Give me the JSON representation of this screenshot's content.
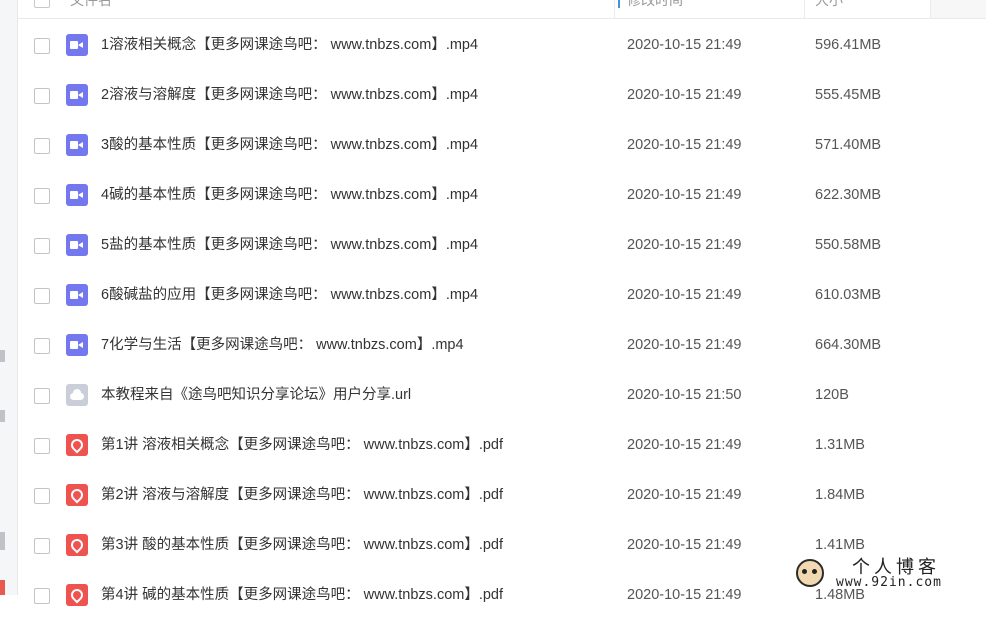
{
  "header": {
    "name_label": "文件名",
    "date_label": "修改时间",
    "size_label": "大小"
  },
  "files": [
    {
      "type": "video-icon",
      "name": "1溶液相关概念【更多网课途鸟吧： www.tnbzs.com】.mp4",
      "date": "2020-10-15 21:49",
      "size": "596.41MB"
    },
    {
      "type": "video-icon",
      "name": "2溶液与溶解度【更多网课途鸟吧： www.tnbzs.com】.mp4",
      "date": "2020-10-15 21:49",
      "size": "555.45MB"
    },
    {
      "type": "video-icon",
      "name": "3酸的基本性质【更多网课途鸟吧： www.tnbzs.com】.mp4",
      "date": "2020-10-15 21:49",
      "size": "571.40MB"
    },
    {
      "type": "video-icon",
      "name": "4碱的基本性质【更多网课途鸟吧： www.tnbzs.com】.mp4",
      "date": "2020-10-15 21:49",
      "size": "622.30MB"
    },
    {
      "type": "video-icon",
      "name": "5盐的基本性质【更多网课途鸟吧： www.tnbzs.com】.mp4",
      "date": "2020-10-15 21:49",
      "size": "550.58MB"
    },
    {
      "type": "video-icon",
      "name": "6酸碱盐的应用【更多网课途鸟吧： www.tnbzs.com】.mp4",
      "date": "2020-10-15 21:49",
      "size": "610.03MB"
    },
    {
      "type": "video-icon",
      "name": "7化学与生活【更多网课途鸟吧： www.tnbzs.com】.mp4",
      "date": "2020-10-15 21:49",
      "size": "664.30MB"
    },
    {
      "type": "link-icon",
      "name": "本教程来自《途鸟吧知识分享论坛》用户分享.url",
      "date": "2020-10-15 21:50",
      "size": "120B"
    },
    {
      "type": "pdf-icon",
      "name": "第1讲  溶液相关概念【更多网课途鸟吧： www.tnbzs.com】.pdf",
      "date": "2020-10-15 21:49",
      "size": "1.31MB"
    },
    {
      "type": "pdf-icon",
      "name": "第2讲  溶液与溶解度【更多网课途鸟吧： www.tnbzs.com】.pdf",
      "date": "2020-10-15 21:49",
      "size": "1.84MB"
    },
    {
      "type": "pdf-icon",
      "name": "第3讲  酸的基本性质【更多网课途鸟吧： www.tnbzs.com】.pdf",
      "date": "2020-10-15 21:49",
      "size": "1.41MB"
    },
    {
      "type": "pdf-icon",
      "name": "第4讲  碱的基本性质【更多网课途鸟吧： www.tnbzs.com】.pdf",
      "date": "2020-10-15 21:49",
      "size": "1.48MB"
    }
  ],
  "watermark": {
    "title": "个人博客",
    "url": "www.92in.com"
  },
  "colors": {
    "video": "#7478ef",
    "pdf": "#ef5350",
    "link": "#c9ced8",
    "sort_accent": "#4a90e2"
  }
}
